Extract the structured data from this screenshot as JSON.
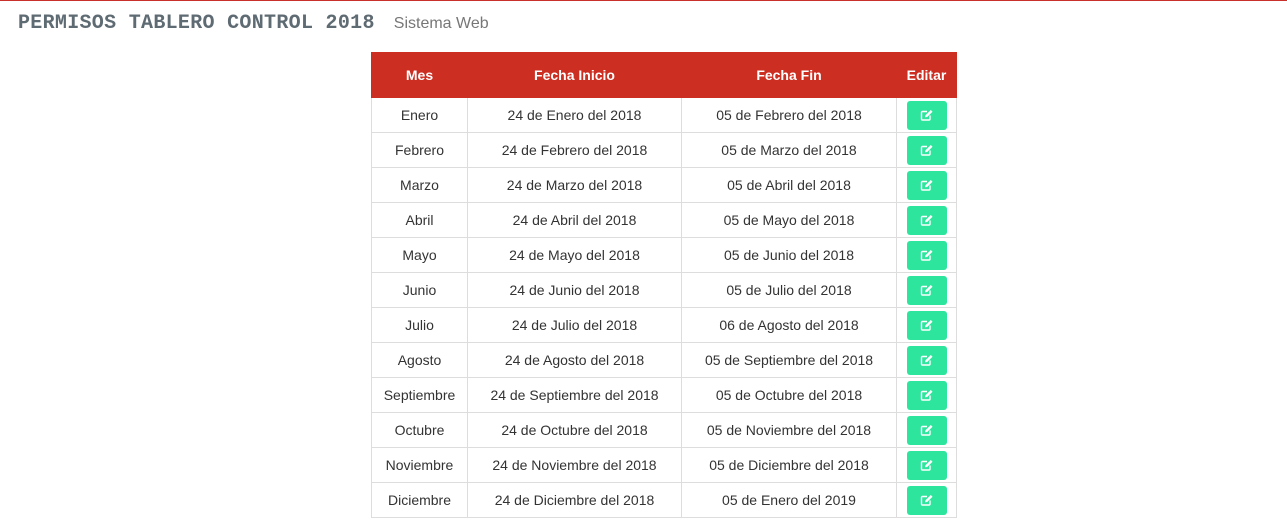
{
  "header": {
    "title": "PERMISOS TABLERO CONTROL 2018",
    "subtitle": "Sistema Web"
  },
  "colors": {
    "accent": "#cc2e22",
    "edit_button": "#2ee59d",
    "title_text": "#5f6b73"
  },
  "table": {
    "columns": [
      "Mes",
      "Fecha Inicio",
      "Fecha Fin",
      "Editar"
    ],
    "edit_icon": "pencil-square-icon",
    "rows": [
      {
        "mes": "Enero",
        "inicio": "24 de Enero del 2018",
        "fin": "05 de Febrero del 2018"
      },
      {
        "mes": "Febrero",
        "inicio": "24 de Febrero del 2018",
        "fin": "05 de Marzo del 2018"
      },
      {
        "mes": "Marzo",
        "inicio": "24 de Marzo del 2018",
        "fin": "05 de Abril del 2018"
      },
      {
        "mes": "Abril",
        "inicio": "24 de Abril del 2018",
        "fin": "05 de Mayo del 2018"
      },
      {
        "mes": "Mayo",
        "inicio": "24 de Mayo del 2018",
        "fin": "05 de Junio del 2018"
      },
      {
        "mes": "Junio",
        "inicio": "24 de Junio del 2018",
        "fin": "05 de Julio del 2018"
      },
      {
        "mes": "Julio",
        "inicio": "24 de Julio del 2018",
        "fin": "06 de Agosto del 2018"
      },
      {
        "mes": "Agosto",
        "inicio": "24 de Agosto del 2018",
        "fin": "05 de Septiembre del 2018"
      },
      {
        "mes": "Septiembre",
        "inicio": "24 de Septiembre del 2018",
        "fin": "05 de Octubre del 2018"
      },
      {
        "mes": "Octubre",
        "inicio": "24 de Octubre del 2018",
        "fin": "05 de Noviembre del 2018"
      },
      {
        "mes": "Noviembre",
        "inicio": "24 de Noviembre del 2018",
        "fin": "05 de Diciembre del 2018"
      },
      {
        "mes": "Diciembre",
        "inicio": "24 de Diciembre del 2018",
        "fin": "05 de Enero del 2019"
      }
    ]
  }
}
